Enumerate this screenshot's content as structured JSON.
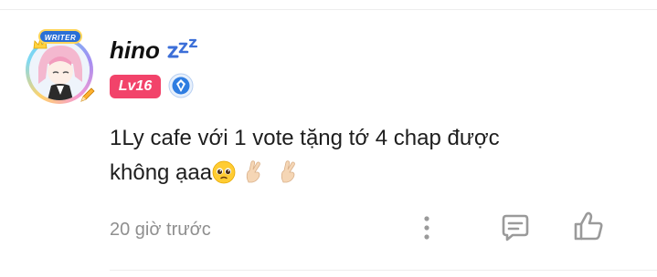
{
  "comment": {
    "username": "hino",
    "level": "Lv16",
    "writer_badge": "WRITER",
    "text_line1": "1Ly cafe với 1 vote tặng tớ 4 chap được",
    "text_line2": "không ạaa",
    "emojis": [
      "pleading-face",
      "crossed-fingers",
      "crossed-fingers"
    ],
    "timestamp": "20 giờ trước"
  },
  "icons": {
    "sleep": "zzz-icon",
    "rank": "shield-icon",
    "more": "more-vertical-icon",
    "reply": "comment-icon",
    "like": "thumbs-up-icon"
  },
  "colors": {
    "level_badge": "#f2436a",
    "writer_badge": "#2a6fd6",
    "rank_badge": "#2f7de1",
    "icon_gray": "#9a9a9a",
    "timestamp": "#8f8f8f"
  }
}
